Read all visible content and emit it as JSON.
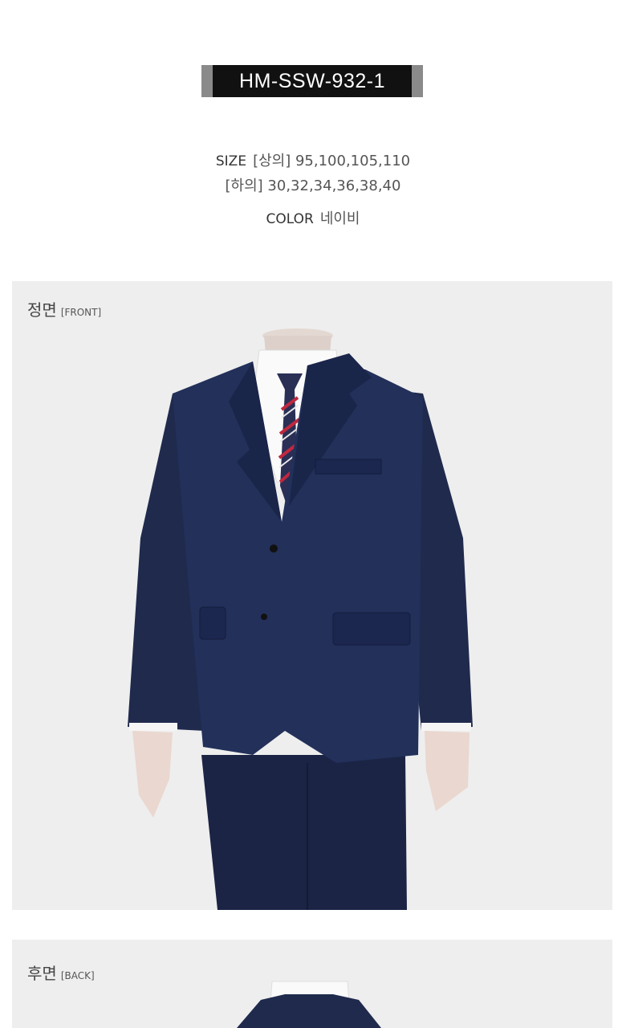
{
  "product": {
    "code": "HM-SSW-932-1"
  },
  "specs": {
    "size_key": "SIZE",
    "size_top": "[상의] 95,100,105,110",
    "size_bottom": "[하의] 30,32,34,36,38,40",
    "color_key": "COLOR",
    "color_value": "네이비"
  },
  "sections": {
    "front": {
      "label_ko": "정면",
      "label_en": "[FRONT]"
    },
    "back": {
      "label_ko": "후면",
      "label_en": "[BACK]"
    }
  },
  "colors": {
    "suit": "#1f2a4d",
    "banner": "#111111",
    "panel_bg": "#eeeeee"
  },
  "icons": {
    "front_image": "navy-suit-front-photo",
    "back_image": "navy-suit-back-photo"
  }
}
